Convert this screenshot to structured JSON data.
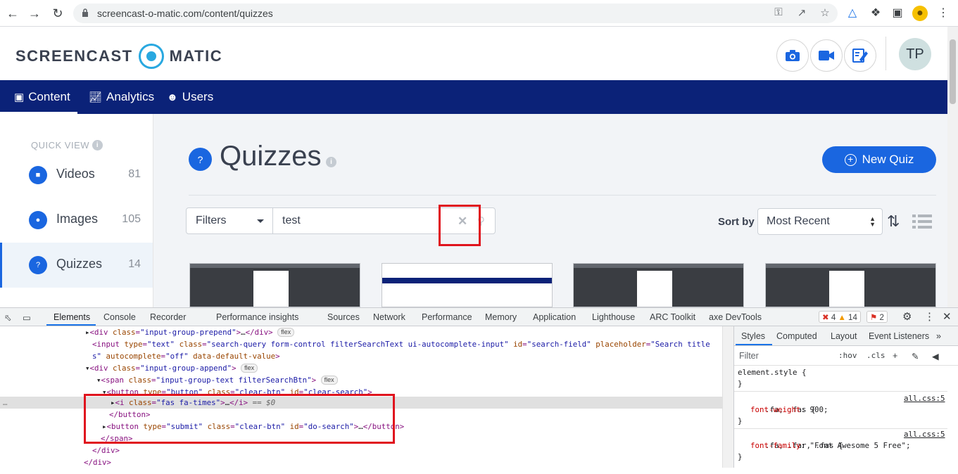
{
  "browser": {
    "url": "screencast-o-matic.com/content/quizzes",
    "icons": [
      "back-icon",
      "forward-icon",
      "reload-icon",
      "lock-icon",
      "key-icon",
      "share-icon",
      "star-icon",
      "extension-icon",
      "puzzle-icon",
      "sidepanel-icon",
      "profile-icon",
      "menu-icon"
    ]
  },
  "app": {
    "logo_left": "SCREENCAST",
    "logo_right": "MATIC",
    "avatar": "TP",
    "nav": [
      {
        "label": "Content"
      },
      {
        "label": "Analytics"
      },
      {
        "label": "Users"
      }
    ]
  },
  "sidebar": {
    "quick_view": "QUICK VIEW",
    "items": [
      {
        "label": "Videos",
        "count": "81"
      },
      {
        "label": "Images",
        "count": "105"
      },
      {
        "label": "Quizzes",
        "count": "14"
      }
    ]
  },
  "main": {
    "title": "Quizzes",
    "new_button": "New Quiz",
    "filters": "Filters",
    "search_value": "test",
    "sort_label": "Sort by",
    "sort_value": "Most Recent"
  },
  "devtools": {
    "tabs": [
      "Elements",
      "Console",
      "Recorder",
      "Performance insights",
      "Sources",
      "Network",
      "Performance",
      "Memory",
      "Application",
      "Lighthouse",
      "ARC Toolkit",
      "axe DevTools"
    ],
    "errors": "4",
    "warnings": "14",
    "issues": "2",
    "style_tabs": [
      "Styles",
      "Computed",
      "Layout",
      "Event Listeners"
    ],
    "filter_placeholder": "Filter",
    "hov": ":hov",
    "cls": ".cls",
    "element_style": "element.style {",
    "close_brace": "}",
    "rule1_sel": ".fa, .fas {",
    "rule1_src": "all.css:5",
    "rule1_prop": "font-weight",
    "rule1_val": "900;",
    "rule2_sel": ".fa, .far, .fas {",
    "rule2_src": "all.css:5",
    "rule2_prop": "font-family",
    "rule2_val": "\"Font Awesome 5 Free\";",
    "flex_pill": "flex",
    "selected_suffix": "== $0",
    "colors": {
      "accent": "#1a66e0",
      "nav": "#0b2278",
      "highlight": "#e0141e"
    }
  }
}
